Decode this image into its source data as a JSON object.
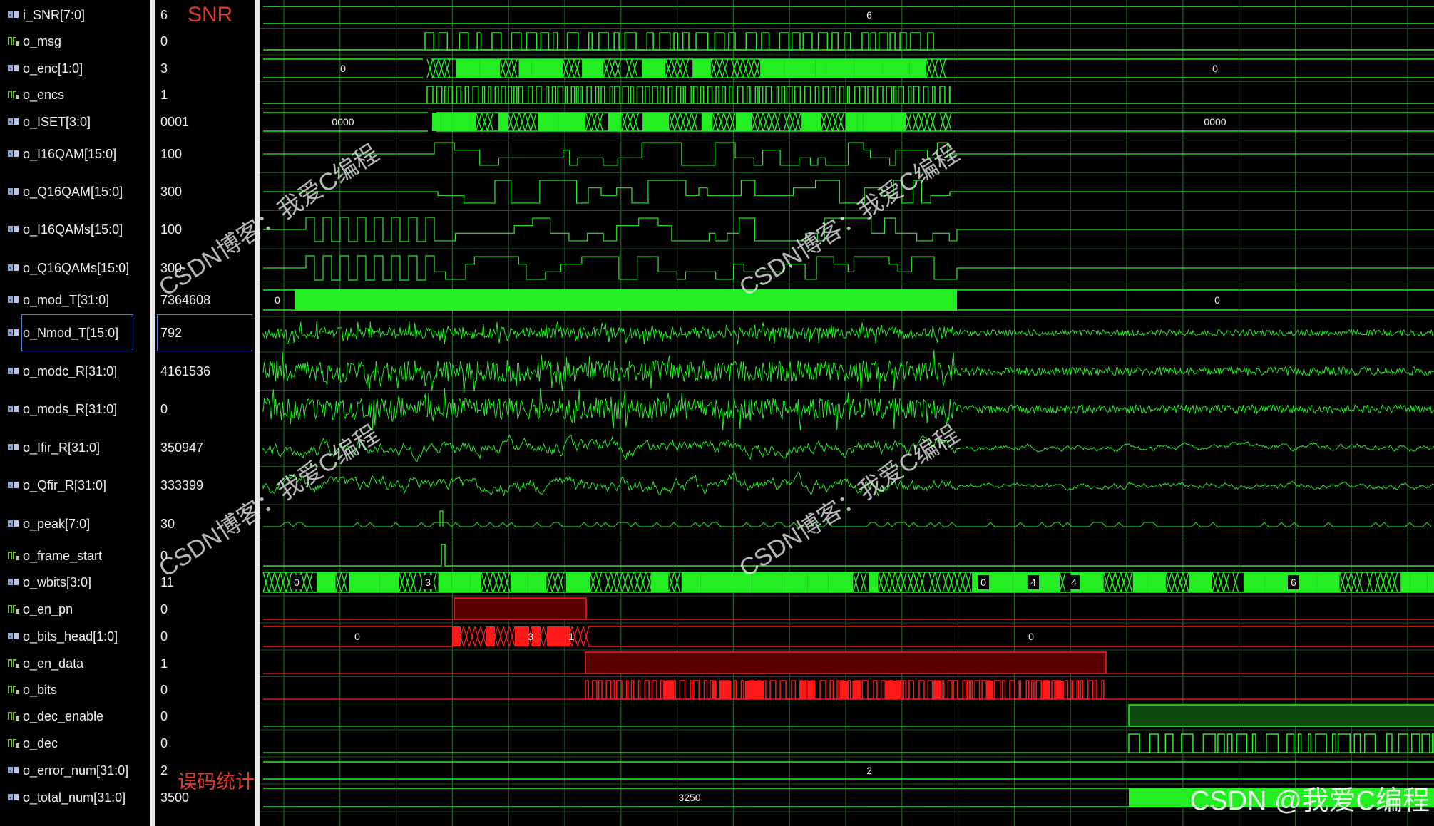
{
  "signals": [
    {
      "name": "i_SNR[7:0]",
      "value": "6",
      "bus": true,
      "display": "6"
    },
    {
      "name": "o_msg",
      "value": "0",
      "bus": false
    },
    {
      "name": "o_enc[1:0]",
      "value": "3",
      "bus": true,
      "display": "0",
      "display_after": "0"
    },
    {
      "name": "o_encs",
      "value": "1",
      "bus": false
    },
    {
      "name": "o_ISET[3:0]",
      "value": "0001",
      "bus": true,
      "display": "0000",
      "display_after": "0000"
    },
    {
      "name": "o_I16QAM[15:0]",
      "value": "100",
      "bus": true
    },
    {
      "name": "o_Q16QAM[15:0]",
      "value": "300",
      "bus": true
    },
    {
      "name": "o_I16QAMs[15:0]",
      "value": "100",
      "bus": true
    },
    {
      "name": "o_Q16QAMs[15:0]",
      "value": "300",
      "bus": true
    },
    {
      "name": "o_mod_T[31:0]",
      "value": "7364608",
      "bus": true,
      "display": "0",
      "display_after": "0"
    },
    {
      "name": "o_Nmod_T[15:0]",
      "value": "792",
      "bus": true
    },
    {
      "name": "o_modc_R[31:0]",
      "value": "4161536",
      "bus": true
    },
    {
      "name": "o_mods_R[31:0]",
      "value": "0",
      "bus": true
    },
    {
      "name": "o_Ifir_R[31:0]",
      "value": "350947",
      "bus": true
    },
    {
      "name": "o_Qfir_R[31:0]",
      "value": "333399",
      "bus": true
    },
    {
      "name": "o_peak[7:0]",
      "value": "30",
      "bus": true
    },
    {
      "name": "o_frame_start",
      "value": "0",
      "bus": false
    },
    {
      "name": "o_wbits[3:0]",
      "value": "11",
      "bus": true,
      "labels": [
        "0",
        "3",
        "0",
        "4",
        "4",
        "6"
      ]
    },
    {
      "name": "o_en_pn",
      "value": "0",
      "bus": false
    },
    {
      "name": "o_bits_head[1:0]",
      "value": "0",
      "bus": true,
      "display": "0",
      "display_after": "0",
      "labels": [
        "3",
        "1"
      ]
    },
    {
      "name": "o_en_data",
      "value": "1",
      "bus": false
    },
    {
      "name": "o_bits",
      "value": "0",
      "bus": false
    },
    {
      "name": "o_dec_enable",
      "value": "0",
      "bus": false
    },
    {
      "name": "o_dec",
      "value": "0",
      "bus": false
    },
    {
      "name": "o_error_num[31:0]",
      "value": "2",
      "bus": true,
      "display": "2"
    },
    {
      "name": "o_total_num[31:0]",
      "value": "3500",
      "bus": true,
      "display": "3250"
    }
  ],
  "selected_signal": "o_Nmod_T[15:0]",
  "annotations": {
    "snr": "SNR",
    "error_stats": "误码统计"
  },
  "watermark_text": "CSDN博客：我爱C编程",
  "credit_text": "CSDN @我爱C编程",
  "colors": {
    "wave_green": "#22ee22",
    "wave_red": "#ff1a1a",
    "dark_red": "#5a0000",
    "grid": "#2e6b2e",
    "separator": "#e8e8e8",
    "selection": "#5a7bd8"
  }
}
